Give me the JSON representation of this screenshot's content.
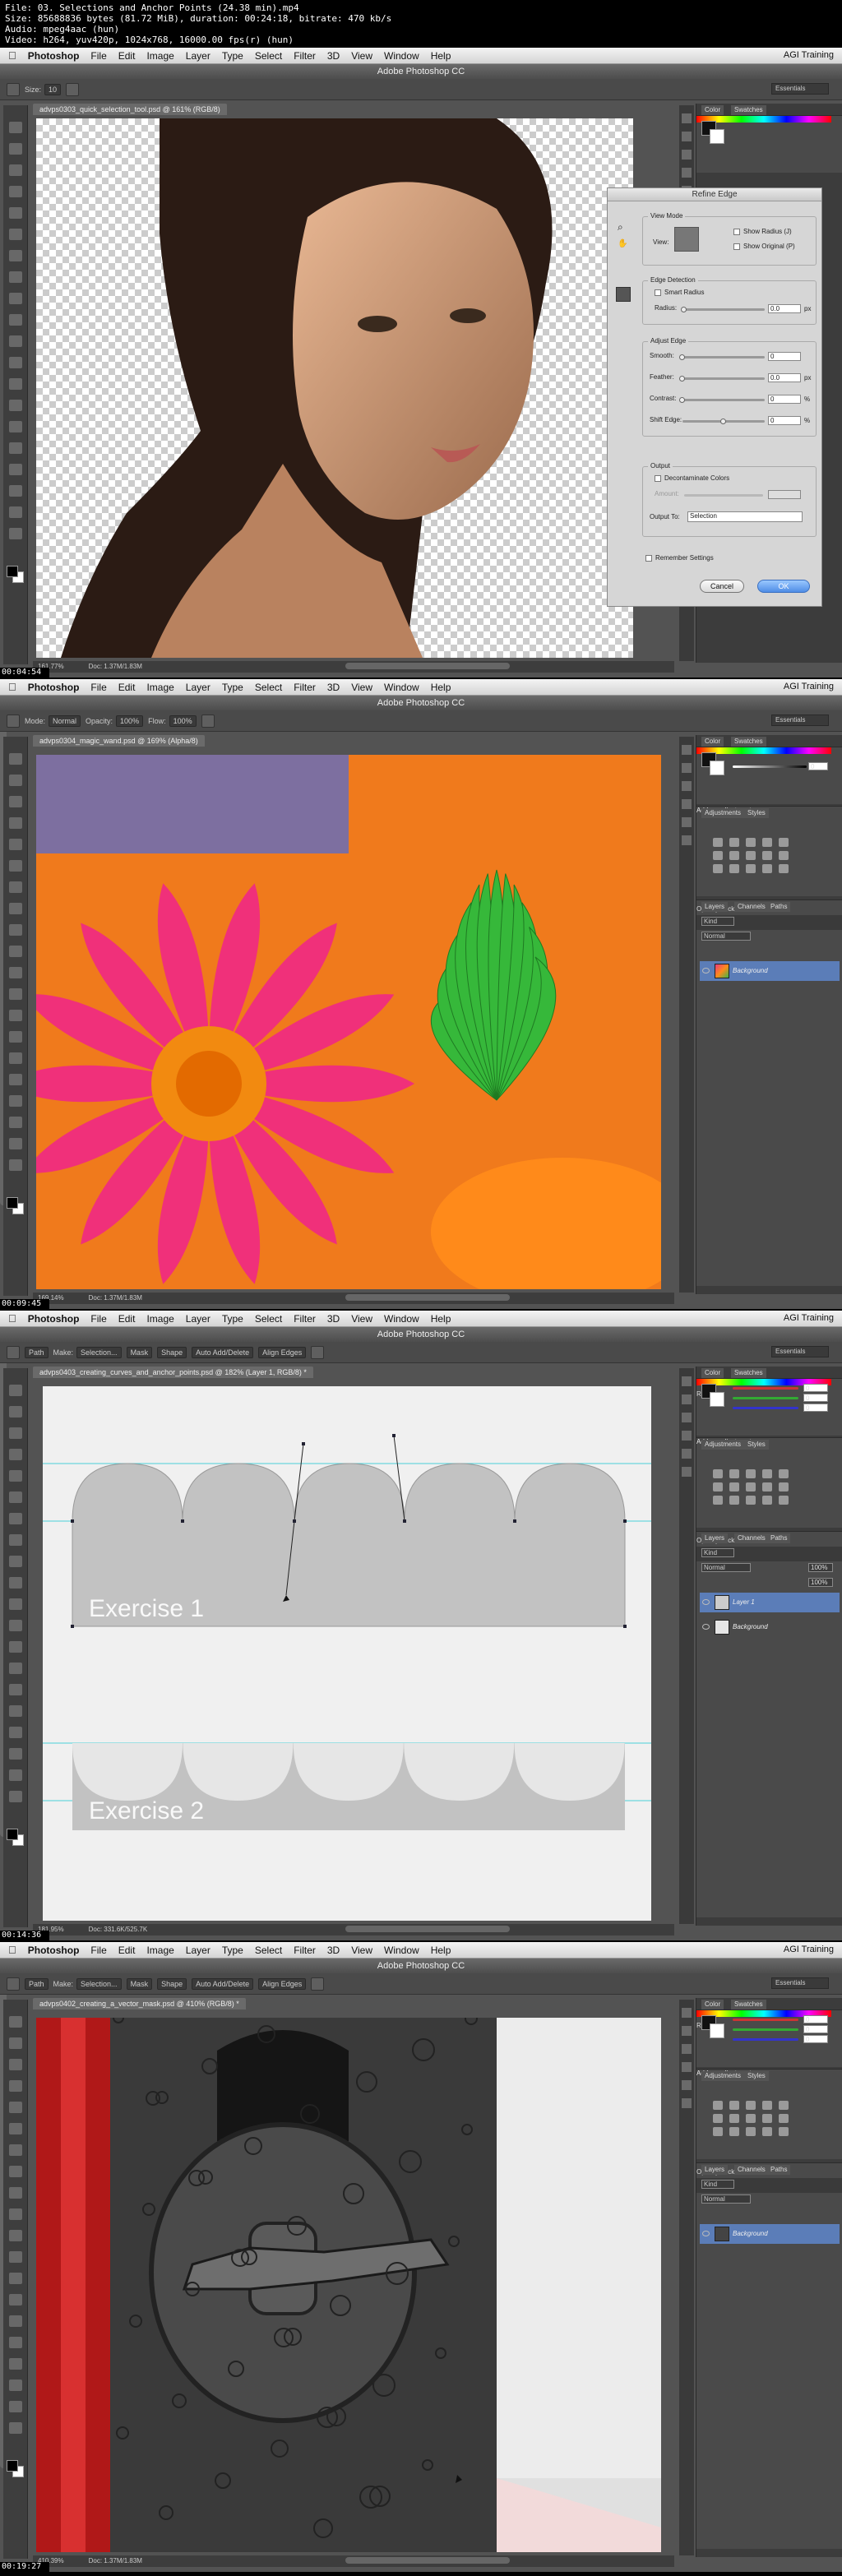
{
  "file_info": {
    "line1": "File: 03. Selections and Anchor Points (24.38 min).mp4",
    "line2": "Size: 85688836 bytes (81.72 MiB), duration: 00:24:18, bitrate: 470 kb/s",
    "line3": "Audio: mpeg4aac (hun)",
    "line4": "Video: h264, yuv420p, 1024x768, 16000.00 fps(r) (hun)"
  },
  "menubar": {
    "app": "Photoshop",
    "items": [
      "File",
      "Edit",
      "Image",
      "Layer",
      "Type",
      "Select",
      "Filter",
      "3D",
      "View",
      "Window",
      "Help"
    ],
    "right": "AGI Training"
  },
  "window_title": "Adobe Photoshop CC",
  "essentials": "Essentials",
  "frames": [
    {
      "timestamp": "00:04:54",
      "doc_tab": "advps0303_quick_selection_tool.psd @ 161% (RGB/8)",
      "status_zoom": "161.77%",
      "status_doc": "Doc: 1.37M/1.83M",
      "options": {
        "size_label": "Size:",
        "size_value": "10"
      },
      "panel_tabs": [
        "Color",
        "Swatches"
      ],
      "dialog": {
        "title": "Refine Edge",
        "view_mode": "View Mode",
        "view": "View:",
        "show_radius": "Show Radius (J)",
        "show_original": "Show Original (P)",
        "edge_detection": "Edge Detection",
        "smart_radius": "Smart Radius",
        "radius": "Radius:",
        "radius_value": "0.0",
        "radius_unit": "px",
        "adjust_edge": "Adjust Edge",
        "smooth": "Smooth:",
        "smooth_value": "0",
        "feather": "Feather:",
        "feather_value": "0.0",
        "feather_unit": "px",
        "contrast": "Contrast:",
        "contrast_value": "0",
        "contrast_unit": "%",
        "shift_edge": "Shift Edge:",
        "shift_value": "0",
        "shift_unit": "%",
        "output": "Output",
        "decontaminate": "Decontaminate Colors",
        "amount": "Amount:",
        "output_to": "Output To:",
        "output_to_value": "Selection",
        "remember": "Remember Settings",
        "cancel": "Cancel",
        "ok": "OK"
      }
    },
    {
      "timestamp": "00:09:45",
      "doc_tab": "advps0304_magic_wand.psd @ 169% (Alpha/8)",
      "status_zoom": "169.14%",
      "status_doc": "Doc: 1.37M/1.83M",
      "options": {
        "mode_label": "Mode:",
        "mode_value": "Normal",
        "opacity_label": "Opacity:",
        "opacity_value": "100%",
        "flow_label": "Flow:",
        "flow_value": "100%"
      },
      "panel_tabs": [
        "Color",
        "Swatches"
      ],
      "adjustments_tabs": [
        "Adjustments",
        "Styles"
      ],
      "add_adjustment": "Add an adjustment",
      "layers_tabs": [
        "Layers",
        "Channels",
        "Paths"
      ],
      "layer_kind": "Kind",
      "blend": "Normal",
      "opacity_label": "Opacity:",
      "lock_label": "Lock:",
      "fill_label": "Fill:",
      "layers": [
        "Background"
      ],
      "color_value": "0"
    },
    {
      "timestamp": "00:14:36",
      "doc_tab": "advps0403_creating_curves_and_anchor_points.psd @ 182% (Layer 1, RGB/8) *",
      "status_zoom": "181.95%",
      "status_doc": "Doc: 331.6K/525.7K",
      "options": {
        "mode_value": "Path",
        "make_label": "Make:",
        "selection": "Selection...",
        "mask": "Mask",
        "shape": "Shape",
        "auto": "Auto Add/Delete",
        "align": "Align Edges"
      },
      "exercise1": "Exercise 1",
      "exercise2": "Exercise 2",
      "panel_tabs": [
        "Color",
        "Swatches"
      ],
      "adjustments_tabs": [
        "Adjustments",
        "Styles"
      ],
      "add_adjustment": "Add an adjustment",
      "layers_tabs": [
        "Layers",
        "Channels",
        "Paths"
      ],
      "layer_kind": "Kind",
      "blend": "Normal",
      "opacity_label": "Opacity:",
      "opacity_value": "100%",
      "lock_label": "Lock:",
      "fill_label": "Fill:",
      "fill_value": "100%",
      "layers": [
        "Layer 1",
        "Background"
      ],
      "rgb_values": [
        "0",
        "0",
        "0"
      ],
      "rgb_labels": [
        "R",
        "G",
        "B"
      ]
    },
    {
      "timestamp": "00:19:27",
      "doc_tab": "advps0402_creating_a_vector_mask.psd @ 410% (RGB/8) *",
      "status_zoom": "410.39%",
      "status_doc": "Doc: 1.37M/1.83M",
      "options": {
        "mode_value": "Path",
        "make_label": "Make:",
        "selection": "Selection...",
        "mask": "Mask",
        "shape": "Shape",
        "auto": "Auto Add/Delete",
        "align": "Align Edges"
      },
      "panel_tabs": [
        "Color",
        "Swatches"
      ],
      "adjustments_tabs": [
        "Adjustments",
        "Styles"
      ],
      "add_adjustment": "Add an adjustment",
      "layers_tabs": [
        "Layers",
        "Channels",
        "Paths"
      ],
      "layer_kind": "Kind",
      "blend": "Normal",
      "opacity_label": "Opacity:",
      "lock_label": "Lock:",
      "fill_label": "Fill:",
      "layers": [
        "Background"
      ],
      "rgb_values": [
        "0",
        "0",
        "0"
      ],
      "rgb_labels": [
        "R",
        "G",
        "B"
      ]
    }
  ],
  "colors": {
    "panel_bg": "#3c3c3c",
    "selected_layer": "#5b7db8",
    "ok_button": "#4f8de6",
    "exercise_shape": "#c2c2c2",
    "guide": "#4ad0d8"
  }
}
